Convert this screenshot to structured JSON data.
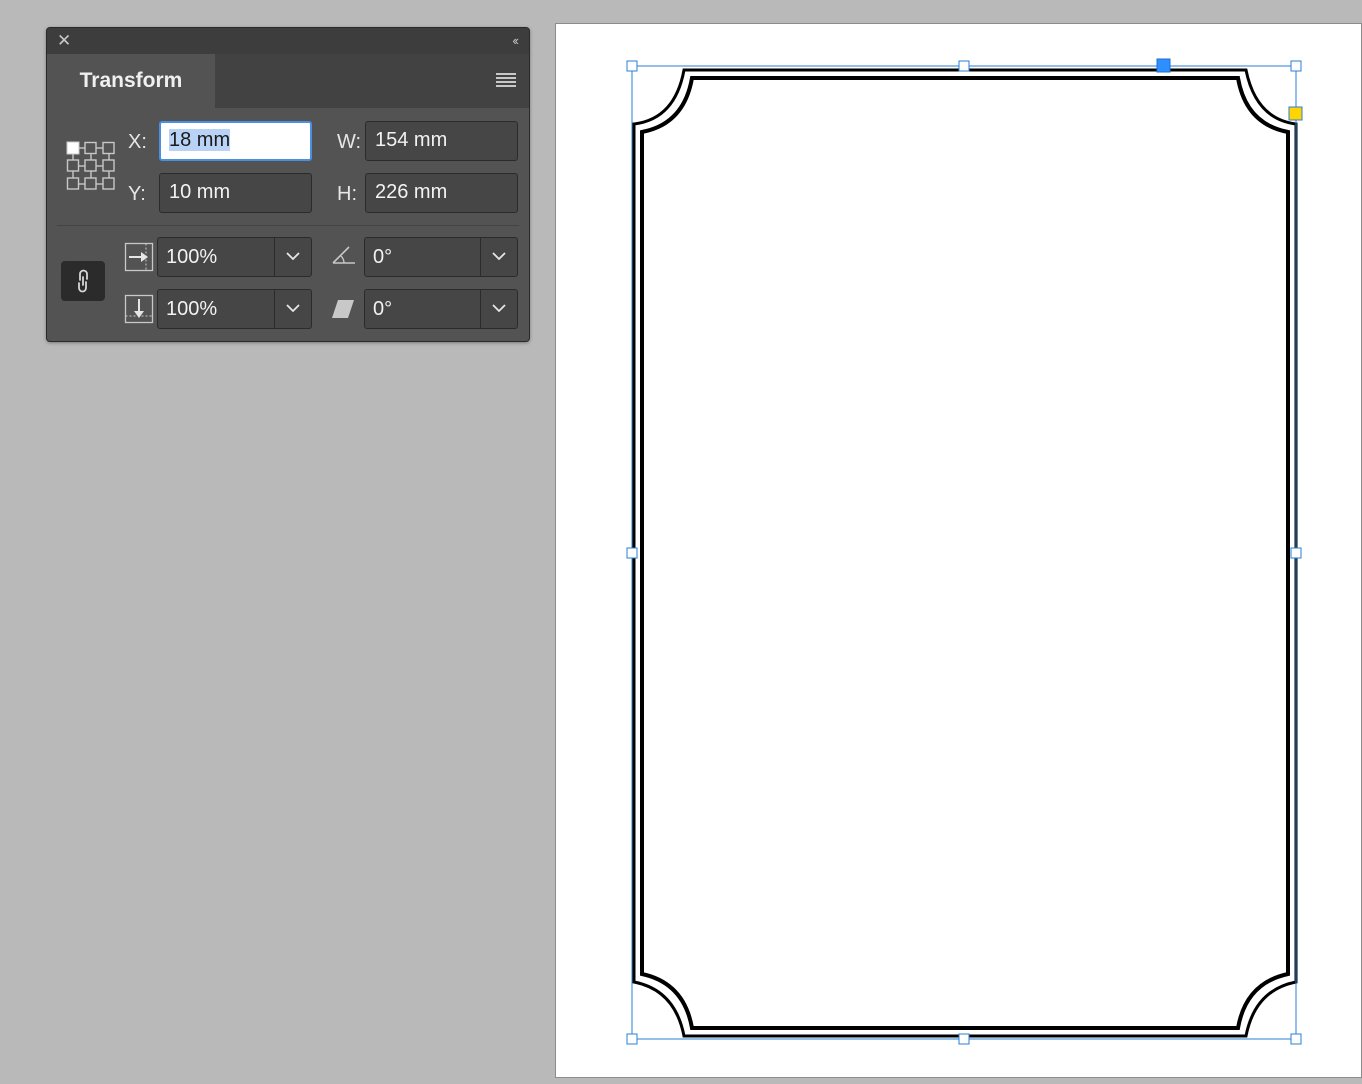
{
  "panel": {
    "close_icon": "close-icon",
    "collapse_glyph": "‹‹",
    "tab_label": "Transform",
    "menu_icon": "panel-menu-icon",
    "reference_point_icon": "reference-point-grid-icon",
    "x_label": "X:",
    "x_value": "18 mm",
    "y_label": "Y:",
    "y_value": "10 mm",
    "w_label": "W:",
    "w_value": "154 mm",
    "h_label": "H:",
    "h_value": "226 mm",
    "scale_x_icon": "scale-x-icon",
    "scale_x_value": "100%",
    "scale_y_icon": "scale-y-icon",
    "scale_y_value": "100%",
    "rotate_icon": "rotate-angle-icon",
    "rotate_value": "0°",
    "shear_icon": "shear-angle-icon",
    "shear_value": "0°",
    "constrain_icon": "constrain-proportions-link-icon"
  },
  "canvas": {
    "selection_color": "#2a7fd4",
    "highlight_handle_color": "#2f8fff",
    "corner_handle_color": "#ffd400",
    "frame_stroke": "#000000"
  }
}
